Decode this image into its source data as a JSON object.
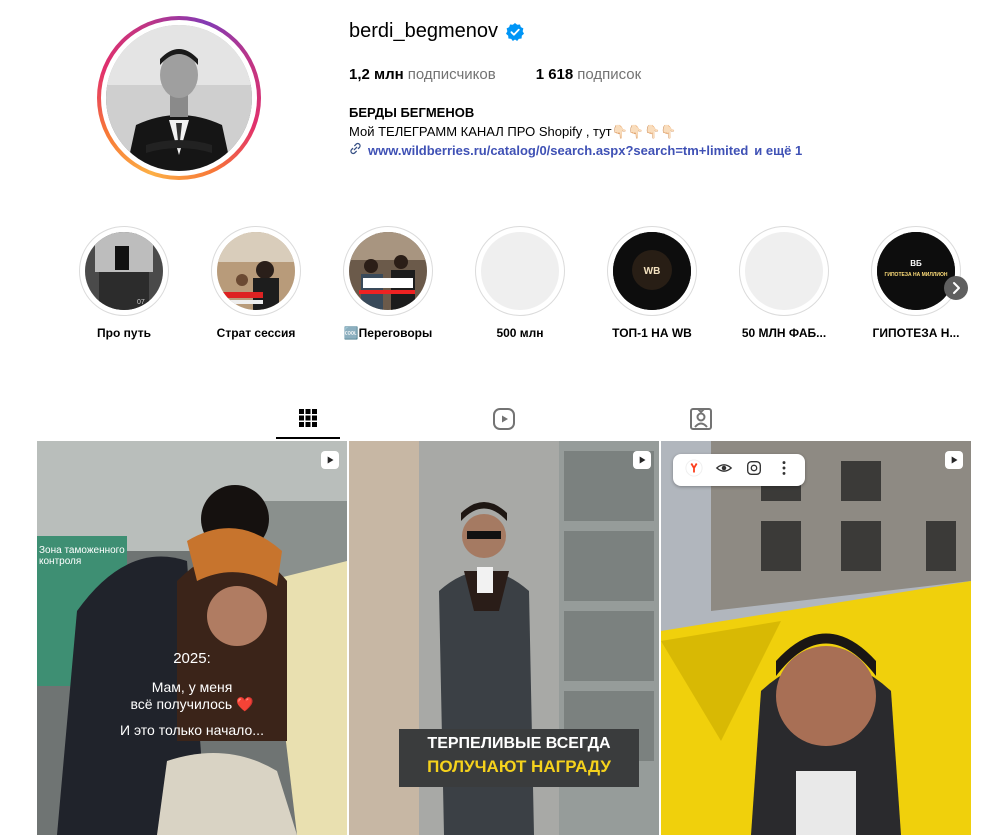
{
  "profile": {
    "username": "berdi_begmenov",
    "verified": true,
    "followers_count": "1,2 млн",
    "followers_label": "подписчиков",
    "following_count": "1 618",
    "following_label": "подписок",
    "full_name": "БЕРДЫ БЕГМЕНОВ",
    "bio": "Мой ТЕЛЕГРАММ КАНАЛ ПРО Shopify , тут👇🏻👇🏻👇🏻👇🏻",
    "link": "www.wildberries.ru/catalog/0/search.aspx?search=tm+limited",
    "link_more": "и ещё 1"
  },
  "highlights": [
    {
      "label": "Про путь"
    },
    {
      "label": "Страт сессия"
    },
    {
      "label": "🆒Переговоры"
    },
    {
      "label": "500 млн"
    },
    {
      "label": "ТОП-1 НА WB",
      "cover_text": "WB"
    },
    {
      "label": "50 МЛН ФАБ..."
    },
    {
      "label": "ГИПОТЕЗА Н...",
      "cover_text": "ВБ",
      "cover_sub": "ГИПОТЕЗА НА МИЛЛИОН"
    }
  ],
  "tabs": [
    {
      "name": "posts",
      "icon": "grid-icon",
      "active": true
    },
    {
      "name": "reels",
      "icon": "reels-icon",
      "active": false
    },
    {
      "name": "tagged",
      "icon": "tagged-icon",
      "active": false
    }
  ],
  "posts": [
    {
      "overlay_year": "2025:",
      "overlay_line1": "Мам, у меня",
      "overlay_line2": "всё получилось ❤️",
      "overlay_line3": "И это только начало...",
      "sign_text": "Зона таможенного контроля"
    },
    {
      "banner_line1": "ТЕРПЕЛИВЫЕ ВСЕГДА",
      "banner_line2": "ПОЛУЧАЮТ НАГРАДУ"
    },
    {
      "browser_icon": "yandex-icon"
    }
  ],
  "colors": {
    "link": "#3f51b5",
    "verified": "#0095f6",
    "muted": "#737373",
    "banner_yellow": "#f5d21c"
  }
}
